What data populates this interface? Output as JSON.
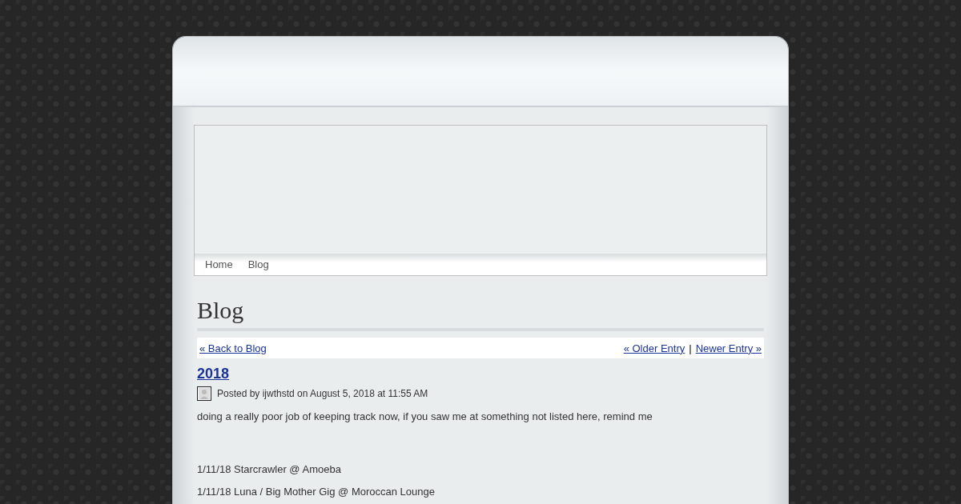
{
  "nav": [
    {
      "label": "Home",
      "selected": false
    },
    {
      "label": "Blog",
      "selected": false
    }
  ],
  "page_title": "Blog",
  "post_nav": {
    "back": "« Back to Blog",
    "older": "« Older Entry",
    "separator": "|",
    "newer": "Newer Entry »"
  },
  "post": {
    "title": "2018",
    "meta": "Posted by ijwthstd on August 5, 2018 at 11:55 AM",
    "paragraphs": [
      "doing a really poor job of keeping track now, if you saw me at something not listed here, remind me",
      "1/11/18 Starcrawler @ Amoeba",
      "1/11/18 Luna / Big Mother Gig @ Moroccan Lounge"
    ]
  }
}
